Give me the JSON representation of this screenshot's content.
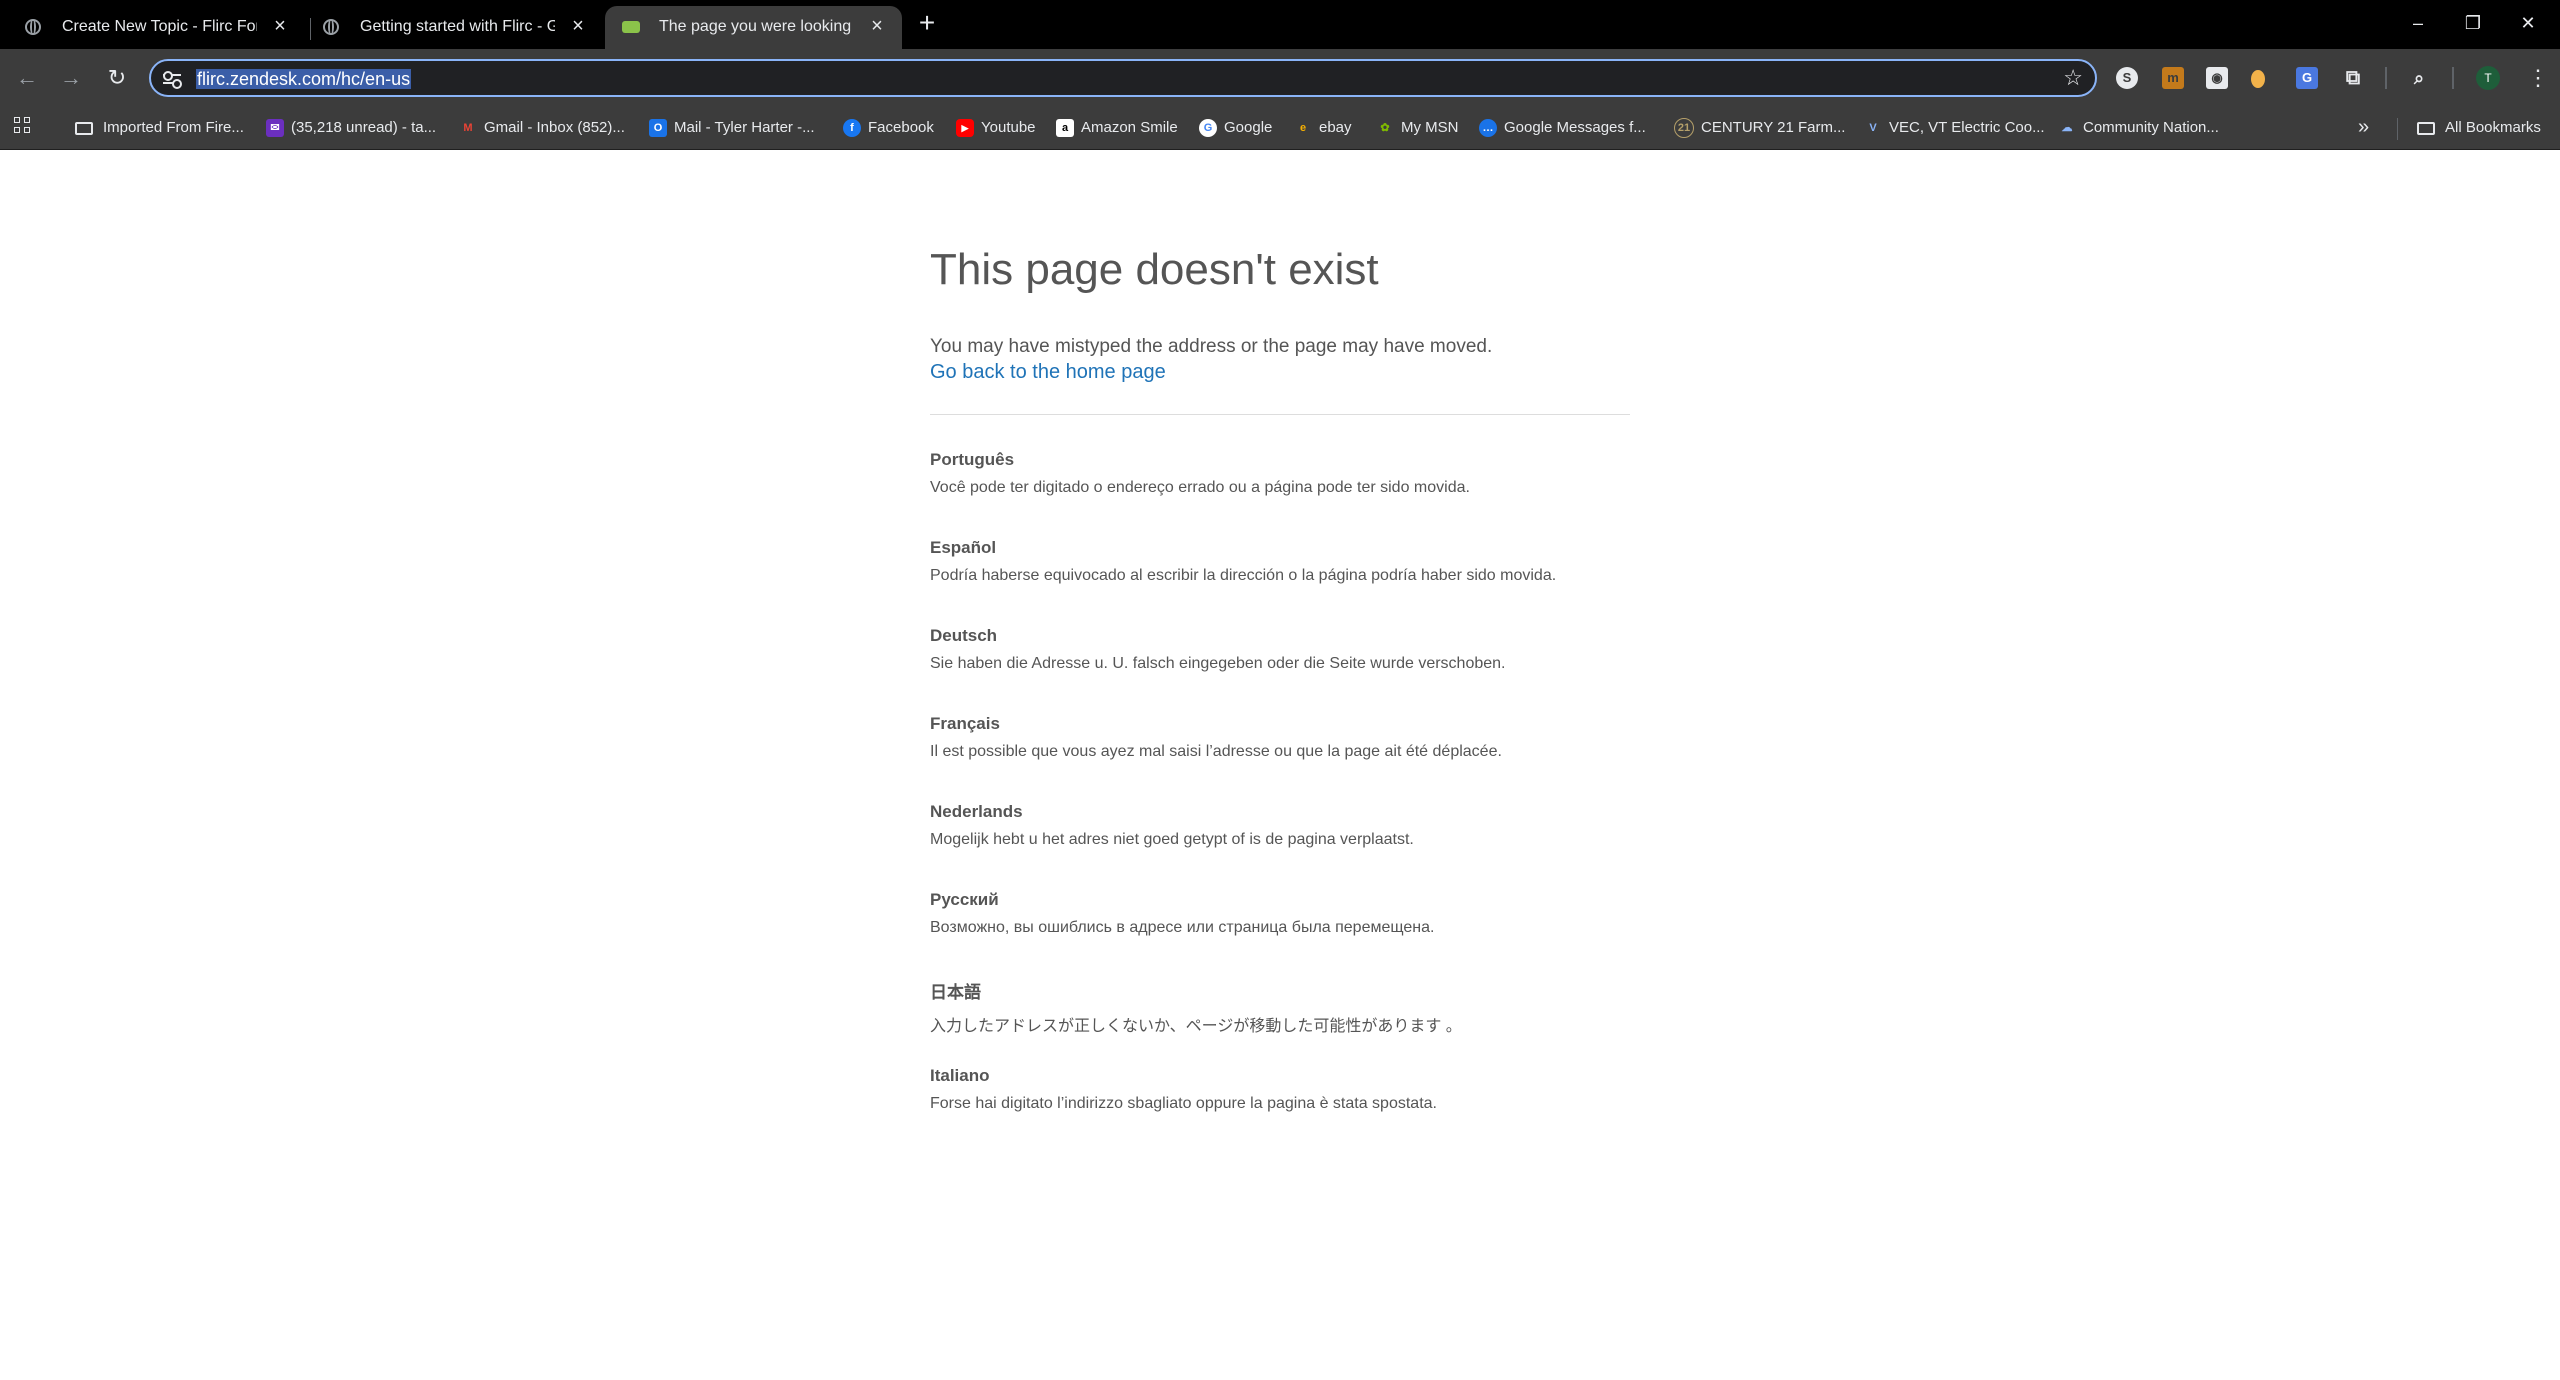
{
  "browser": {
    "tabs": [
      {
        "title": "Create New Topic - Flirc Forums",
        "active": false
      },
      {
        "title": "Getting started with Flirc - Getting started with Flirc",
        "active": false
      },
      {
        "title": "The page you were looking for doesn't exist",
        "active": true
      }
    ],
    "new_tab_label": "+",
    "address_bar": {
      "url": "flirc.zendesk.com/hc/en-us"
    },
    "bookmarks": [
      {
        "label": "Imported From Fire...",
        "icon": "folder-icon"
      },
      {
        "label": "(35,218 unread) - ta...",
        "icon": "yahoo-mail-icon"
      },
      {
        "label": "Gmail - Inbox (852)...",
        "icon": "gmail-icon"
      },
      {
        "label": "Mail - Tyler Harter -...",
        "icon": "outlook-icon"
      },
      {
        "label": "Facebook",
        "icon": "facebook-icon"
      },
      {
        "label": "Youtube",
        "icon": "youtube-icon"
      },
      {
        "label": "Amazon Smile",
        "icon": "amazon-icon"
      },
      {
        "label": "Google",
        "icon": "google-icon"
      },
      {
        "label": "ebay",
        "icon": "ebay-icon"
      },
      {
        "label": "My MSN",
        "icon": "msn-icon"
      },
      {
        "label": "Google Messages f...",
        "icon": "messages-icon"
      },
      {
        "label": "CENTURY 21 Farm...",
        "icon": "century21-icon"
      },
      {
        "label": "VEC, VT Electric Coo...",
        "icon": "vec-icon"
      },
      {
        "label": "Community Nation...",
        "icon": "community-icon"
      }
    ],
    "all_bookmarks_label": "All Bookmarks",
    "profile_initial": "T"
  },
  "page": {
    "title": "This page doesn't exist",
    "description": "You may have mistyped the address or the page may have moved.",
    "home_link": "Go back to the home page",
    "languages": [
      {
        "name": "Português",
        "text": "Você pode ter digitado o endereço errado ou a página pode ter sido movida."
      },
      {
        "name": "Español",
        "text": "Podría haberse equivocado al escribir la dirección o la página podría haber sido movida."
      },
      {
        "name": "Deutsch",
        "text": "Sie haben die Adresse u. U. falsch eingegeben oder die Seite wurde verschoben."
      },
      {
        "name": "Français",
        "text": "Il est possible que vous ayez mal saisi l’adresse ou que la page ait été déplacée."
      },
      {
        "name": "Nederlands",
        "text": "Mogelijk hebt u het adres niet goed getypt of is de pagina verplaatst."
      },
      {
        "name": "Русский",
        "text": "Возможно, вы ошиблись в адресе или страница была перемещена."
      },
      {
        "name": "日本語",
        "text": "入力したアドレスが正しくないか、ページが移動した可能性があります 。"
      },
      {
        "name": "Italiano",
        "text": "Forse hai digitato l’indirizzo sbagliato oppure la pagina è stata spostata."
      }
    ]
  },
  "colors": {
    "chrome_dark": "#000000",
    "toolbar": "#3c3c3c",
    "focus_ring": "#8ab4f8",
    "link": "#1f73b7",
    "body_text": "#555555"
  }
}
